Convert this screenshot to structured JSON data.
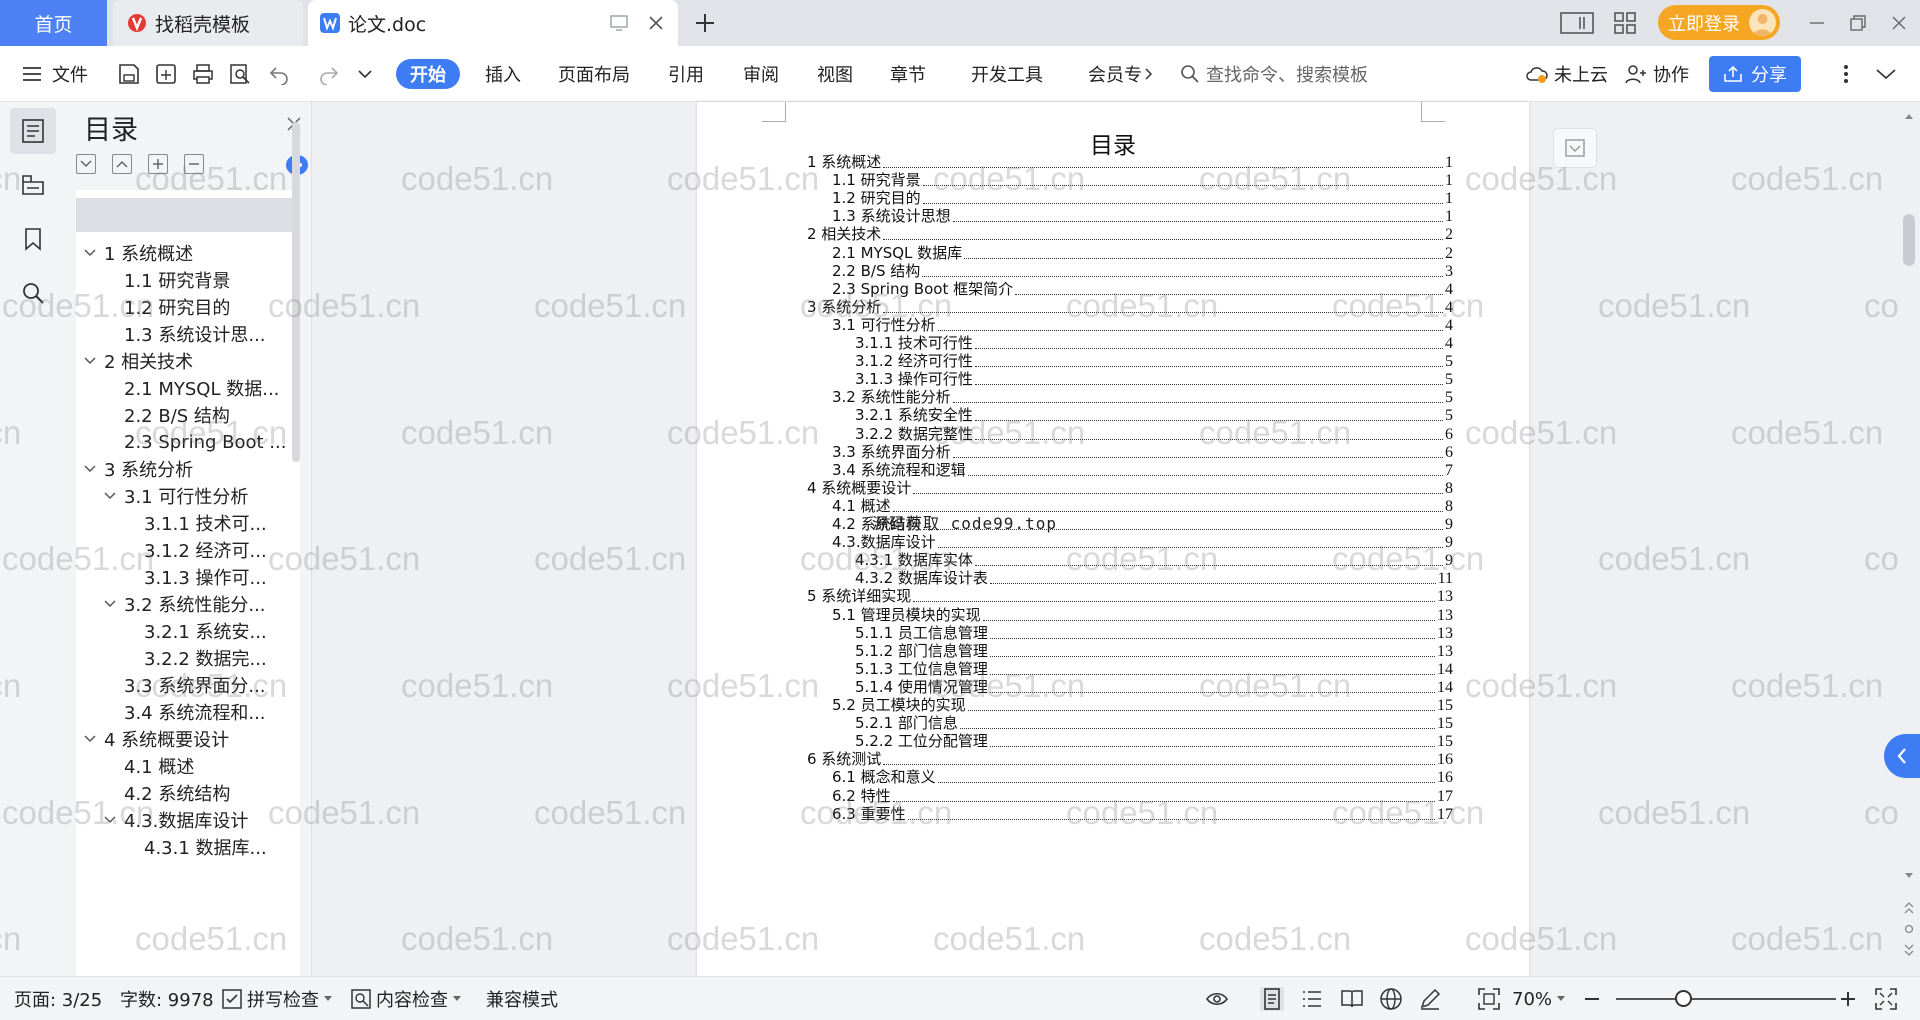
{
  "tabs": {
    "home": "首页",
    "template": "找稻壳模板",
    "doc": "论文.doc",
    "login": "立即登录"
  },
  "toolbar": {
    "file": "文件",
    "menus": [
      "开始",
      "插入",
      "页面布局",
      "引用",
      "审阅",
      "视图",
      "章节",
      "开发工具",
      "会员专"
    ],
    "search_placeholder": "查找命令、搜索模板",
    "cloud": "未上云",
    "collab": "协作",
    "share": "分享"
  },
  "outline": {
    "title": "目录",
    "items": [
      {
        "text": "1 系统概述",
        "level": 1,
        "caret": true
      },
      {
        "text": "1.1  研究背景",
        "level": 2,
        "caret": false
      },
      {
        "text": "1.2 研究目的",
        "level": 2,
        "caret": false
      },
      {
        "text": "1.3 系统设计思...",
        "level": 2,
        "caret": false
      },
      {
        "text": "2 相关技术",
        "level": 1,
        "caret": true
      },
      {
        "text": "2.1 MYSQL 数据...",
        "level": 2,
        "caret": false
      },
      {
        "text": "2.2 B/S 结构",
        "level": 2,
        "caret": false
      },
      {
        "text": "2.3 Spring Boot ...",
        "level": 2,
        "caret": false
      },
      {
        "text": "3 系统分析",
        "level": 1,
        "caret": true
      },
      {
        "text": "3.1 可行性分析",
        "level": 2,
        "caret": true
      },
      {
        "text": "3.1.1 技术可...",
        "level": 3,
        "caret": false
      },
      {
        "text": "3.1.2 经济可...",
        "level": 3,
        "caret": false
      },
      {
        "text": "3.1.3 操作可...",
        "level": 3,
        "caret": false
      },
      {
        "text": "3.2 系统性能分...",
        "level": 2,
        "caret": true
      },
      {
        "text": "3.2.1  系统安...",
        "level": 3,
        "caret": false
      },
      {
        "text": "3.2.2  数据完...",
        "level": 3,
        "caret": false
      },
      {
        "text": "3.3 系统界面分...",
        "level": 2,
        "caret": false
      },
      {
        "text": "3.4 系统流程和...",
        "level": 2,
        "caret": false
      },
      {
        "text": "4 系统概要设计",
        "level": 1,
        "caret": true
      },
      {
        "text": "4.1 概述",
        "level": 2,
        "caret": false
      },
      {
        "text": "4.2 系统结构",
        "level": 2,
        "caret": false
      },
      {
        "text": "4.3.数据库设计",
        "level": 2,
        "caret": true
      },
      {
        "text": "4.3.1 数据库...",
        "level": 3,
        "caret": false
      }
    ]
  },
  "document": {
    "title": "目录",
    "overlay": "源码获取 code99.top",
    "toc": [
      {
        "label": "1 系统概述",
        "page": "1",
        "indent": 0
      },
      {
        "label": "1.1  研究背景",
        "page": "1",
        "indent": 1
      },
      {
        "label": "1.2 研究目的",
        "page": "1",
        "indent": 1
      },
      {
        "label": "1.3 系统设计思想",
        "page": "1",
        "indent": 1
      },
      {
        "label": "2 相关技术",
        "page": "2",
        "indent": 0
      },
      {
        "label": "2.1 MYSQL 数据库",
        "page": "2",
        "indent": 1
      },
      {
        "label": "2.2 B/S 结构",
        "page": "3",
        "indent": 1
      },
      {
        "label": "2.3 Spring Boot 框架简介",
        "page": "4",
        "indent": 1
      },
      {
        "label": "3 系统分析",
        "page": "4",
        "indent": 0
      },
      {
        "label": "3.1 可行性分析",
        "page": "4",
        "indent": 1
      },
      {
        "label": "3.1.1 技术可行性",
        "page": "4",
        "indent": 2
      },
      {
        "label": "3.1.2 经济可行性",
        "page": "5",
        "indent": 2
      },
      {
        "label": "3.1.3 操作可行性",
        "page": "5",
        "indent": 2
      },
      {
        "label": "3.2 系统性能分析",
        "page": "5",
        "indent": 1
      },
      {
        "label": "3.2.1  系统安全性",
        "page": "5",
        "indent": 2
      },
      {
        "label": "3.2.2  数据完整性",
        "page": "6",
        "indent": 2
      },
      {
        "label": "3.3 系统界面分析",
        "page": "6",
        "indent": 1
      },
      {
        "label": "3.4 系统流程和逻辑",
        "page": "7",
        "indent": 1
      },
      {
        "label": "4 系统概要设计",
        "page": "8",
        "indent": 0
      },
      {
        "label": "4.1 概述",
        "page": "8",
        "indent": 1
      },
      {
        "label": "4.2 系统结构",
        "page": "9",
        "indent": 1
      },
      {
        "label": "4.3.数据库设计",
        "page": "9",
        "indent": 1
      },
      {
        "label": "4.3.1 数据库实体",
        "page": "9",
        "indent": 2
      },
      {
        "label": "4.3.2 数据库设计表",
        "page": "11",
        "indent": 2
      },
      {
        "label": "5 系统详细实现",
        "page": "13",
        "indent": 0
      },
      {
        "label": "5.1  管理员模块的实现",
        "page": "13",
        "indent": 1
      },
      {
        "label": "5.1.1  员工信息管理",
        "page": "13",
        "indent": 2
      },
      {
        "label": "5.1.2  部门信息管理",
        "page": "13",
        "indent": 2
      },
      {
        "label": "5.1.3  工位信息管理",
        "page": "14",
        "indent": 2
      },
      {
        "label": "5.1.4  使用情况管理",
        "page": "14",
        "indent": 2
      },
      {
        "label": "5.2 员工模块的实现",
        "page": "15",
        "indent": 1
      },
      {
        "label": "5.2.1  部门信息",
        "page": "15",
        "indent": 2
      },
      {
        "label": "5.2.2  工位分配管理",
        "page": "15",
        "indent": 2
      },
      {
        "label": "6 系统测试",
        "page": "16",
        "indent": 0
      },
      {
        "label": "6.1 概念和意义",
        "page": "16",
        "indent": 1
      },
      {
        "label": "6.2 特性",
        "page": "17",
        "indent": 1
      },
      {
        "label": "6.3 重要性",
        "page": "17",
        "indent": 1
      }
    ]
  },
  "watermark": "code51.cn",
  "statusbar": {
    "page": "页面: 3/25",
    "words": "字数: 9978",
    "spell": "拼写检查",
    "content": "内容检查",
    "compat": "兼容模式",
    "zoom": "70%"
  },
  "colors": {
    "accent": "#3d7cf3",
    "login": "#f5a623"
  }
}
